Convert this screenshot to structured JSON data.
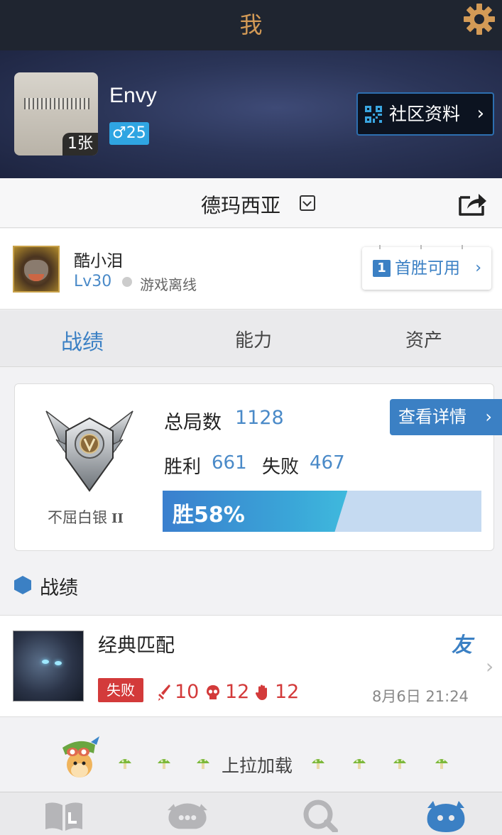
{
  "topbar": {
    "title": "我",
    "settings_icon": "gear-icon",
    "accent": "#d39a56"
  },
  "profile": {
    "name": "Envy",
    "photo_count": "1张",
    "gender_age": "♂25",
    "community_button": "社区资料",
    "qr_icon": "qr-code-icon"
  },
  "server": {
    "name": "德玛西亚",
    "dropdown_icon": "dropdown-icon",
    "share_icon": "share-icon"
  },
  "summoner": {
    "name": "酷小泪",
    "level": "Lv30",
    "status": "游戏离线",
    "first_win_num": "1",
    "first_win_label": "首胜可用"
  },
  "tabs": [
    {
      "label": "战绩",
      "active": true
    },
    {
      "label": "能力",
      "active": false
    },
    {
      "label": "资产",
      "active": false
    }
  ],
  "stats": {
    "rank_name": "不屈白银",
    "rank_tier": "II",
    "total_label": "总局数",
    "total_value": "1128",
    "win_label": "胜利",
    "win_value": "661",
    "lose_label": "失败",
    "lose_value": "467",
    "detail_button": "查看详情",
    "winrate_text": "胜58%",
    "winrate": 0.58
  },
  "section": {
    "title": "战绩"
  },
  "match": {
    "type": "经典匹配",
    "tag": "友",
    "result": "失败",
    "kills": "10",
    "deaths": "12",
    "assists": "12",
    "time": "8月6日 21:24"
  },
  "load_more": {
    "text": "上拉加载"
  },
  "bottom_nav": [
    {
      "icon": "book-icon",
      "active": false
    },
    {
      "icon": "chat-icon",
      "active": false
    },
    {
      "icon": "search-icon",
      "active": false
    },
    {
      "icon": "profile-icon",
      "active": true
    }
  ],
  "colors": {
    "primary": "#3b80c4",
    "loss": "#d33a3a",
    "nav_inactive": "#b5b5b8"
  }
}
